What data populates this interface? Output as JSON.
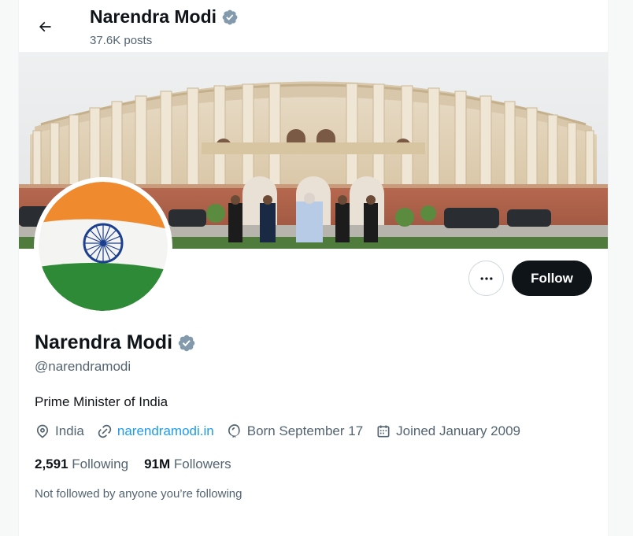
{
  "colors": {
    "badge": "#829aab",
    "link": "#1d9bf0",
    "secondary_text": "#536471",
    "follow_bg": "#0f1419"
  },
  "header": {
    "name": "Narendra Modi",
    "posts": "37.6K posts"
  },
  "banner": {
    "image": "parliament-building-photo"
  },
  "avatar": {
    "image": "indian-flag-avatar"
  },
  "actions": {
    "follow_label": "Follow",
    "more_icon": "more-dots-icon"
  },
  "profile": {
    "name": "Narendra Modi",
    "handle": "@narendramodi",
    "bio": "Prime Minister of India",
    "location": "India",
    "website": "narendramodi.in",
    "birthday": "Born September 17",
    "joined": "Joined January 2009"
  },
  "stats": {
    "following_count": "2,591",
    "following_label": "Following",
    "followers_count": "91M",
    "followers_label": "Followers"
  },
  "not_followed": "Not followed by anyone you’re following"
}
